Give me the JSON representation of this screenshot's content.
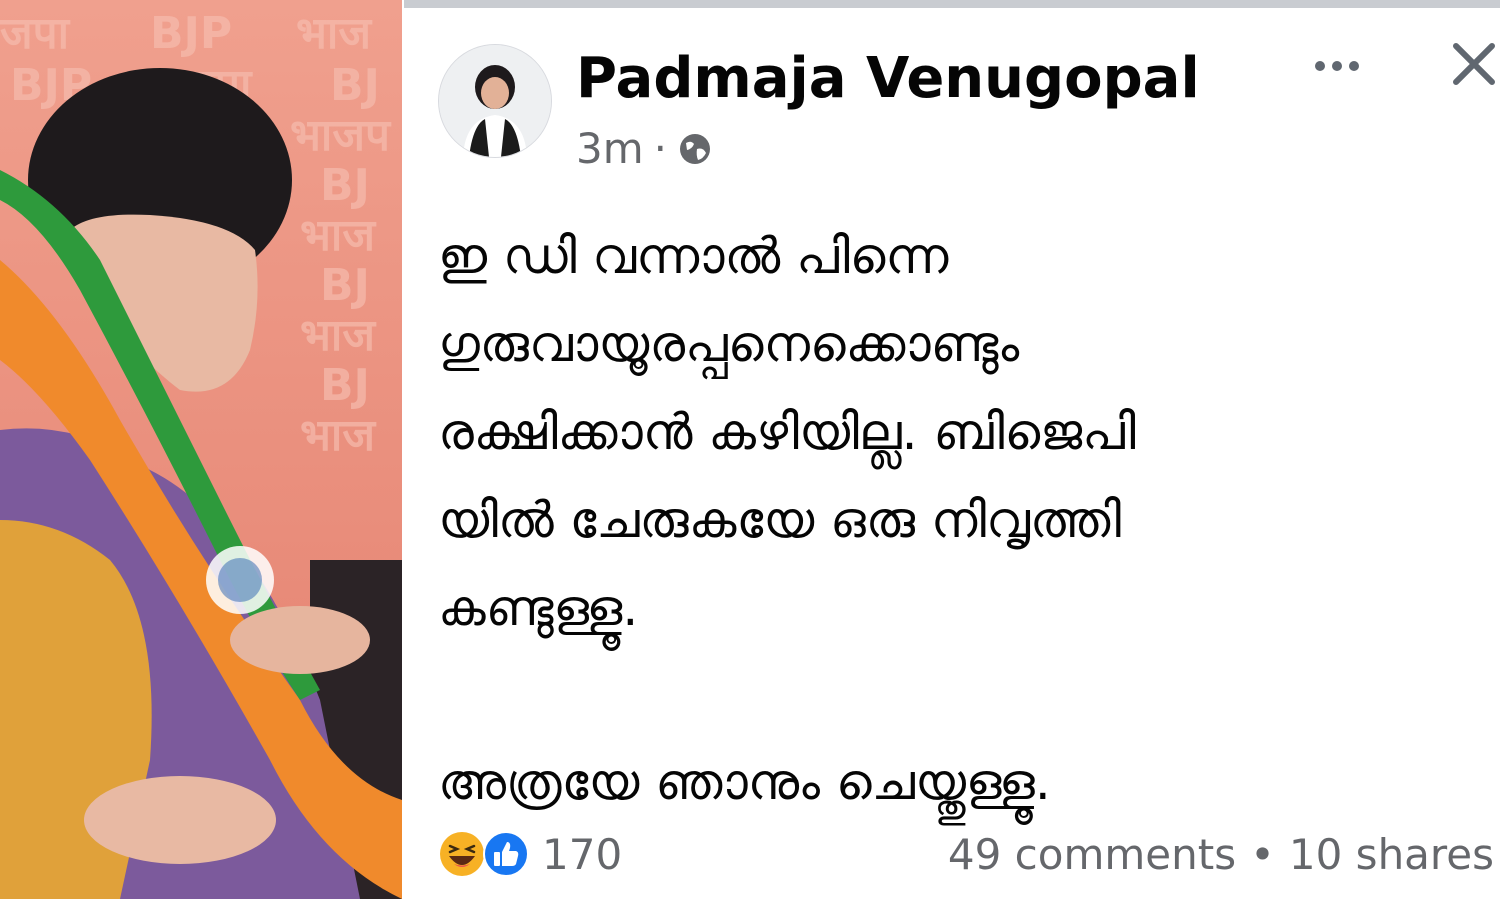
{
  "photo": {
    "watermark_texts": [
      "जपा",
      "BJP",
      "भाज",
      "BJP",
      "भाजपा",
      "BJ",
      "भाजप",
      "BJ",
      "भाज",
      "BJ",
      "भाज",
      "BJ",
      "भाज"
    ]
  },
  "post": {
    "author": "Padmaja Venugopal",
    "time": "3m",
    "separator": "·",
    "privacy_icon": "globe-icon",
    "more_icon": "more-horizontal-icon",
    "close_icon": "close-icon",
    "lines": [
      "ഇ ഡി വന്നാൽ പിന്നെ",
      "ഗുരുവായൂരപ്പനെക്കൊണ്ടും",
      "രക്ഷിക്കാൻ കഴിയില്ല. ബിജെപി",
      "യിൽ ചേരുകയേ ഒരു നിവൃത്തി",
      "കണ്ടുള്ളൂ."
    ],
    "last_line": "അത്രയേ ഞാനും ചെയ്തുള്ളൂ."
  },
  "footer": {
    "reaction_icons": [
      "haha-icon",
      "like-icon"
    ],
    "reaction_count": "170",
    "comments": "49 comments",
    "bullet": "•",
    "shares": "10 shares"
  },
  "colors": {
    "text": "#050505",
    "secondary": "#65676b",
    "like_blue": "#1877f2",
    "haha_yellow": "#f7b125",
    "photo_bg": "#e98c78"
  }
}
